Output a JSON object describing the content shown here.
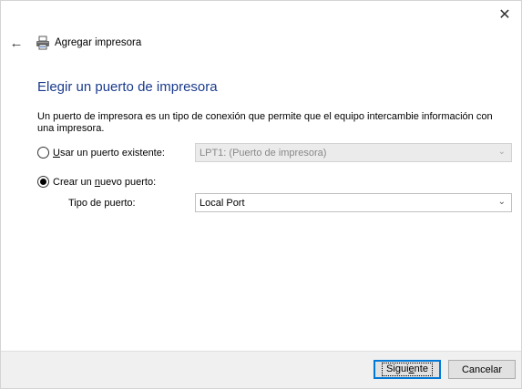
{
  "window": {
    "close_glyph": "✕",
    "back_glyph": "←",
    "title": "Agregar impresora"
  },
  "main": {
    "heading": "Elegir un puerto de impresora",
    "description": "Un puerto de impresora es un tipo de conexión que permite que el equipo intercambie información con una impresora.",
    "existing_port": {
      "label_prefix": "",
      "label_underlined": "U",
      "label_suffix": "sar un puerto existente:",
      "selected": false,
      "value": "LPT1: (Puerto de impresora)",
      "enabled": false
    },
    "new_port": {
      "label_prefix": "Crear un ",
      "label_underlined": "n",
      "label_suffix": "uevo puerto:",
      "selected": true
    },
    "port_type": {
      "label": "Tipo de puerto:",
      "value": "Local Port"
    }
  },
  "footer": {
    "next_prefix": "Sigui",
    "next_underlined": "e",
    "next_suffix": "nte",
    "cancel": "Cancelar"
  },
  "colors": {
    "heading": "#1a3b8c",
    "primary_border": "#0078d7",
    "footer_bg": "#f0f0f0"
  },
  "icons": {
    "close": "close-icon",
    "back": "back-arrow-icon",
    "printer": "printer-icon",
    "dropdown": "chevron-down-icon"
  }
}
